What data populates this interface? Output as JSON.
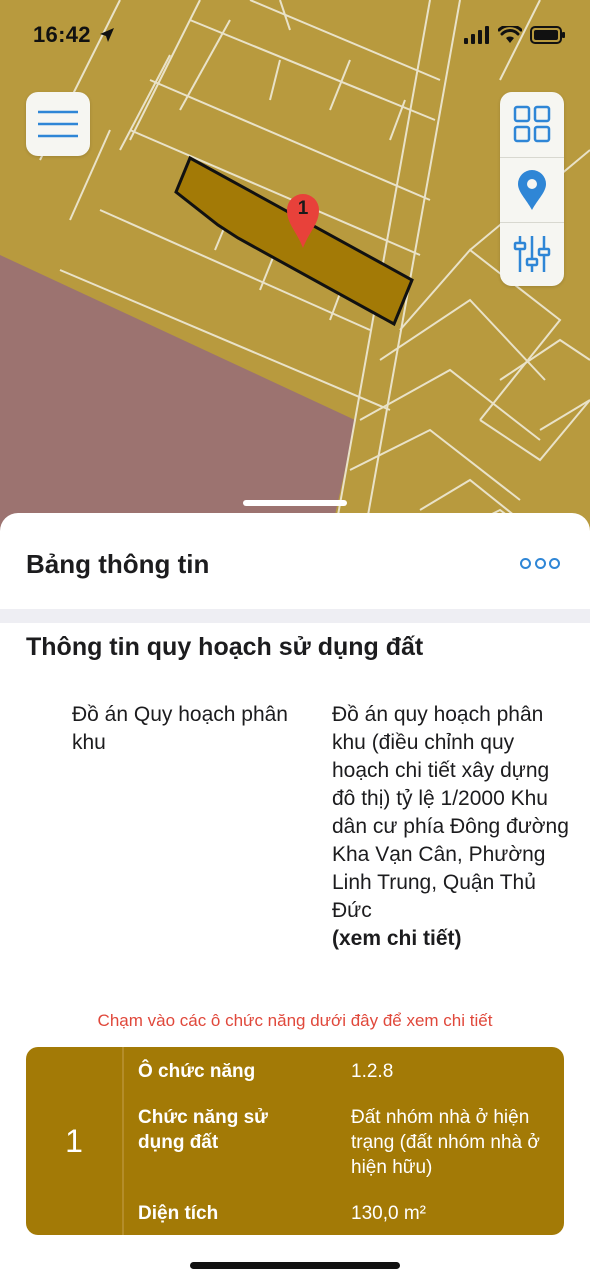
{
  "status_bar": {
    "time": "16:42"
  },
  "map": {
    "marker_label": "1"
  },
  "sheet": {
    "title": "Bảng thông tin",
    "section_title": "Thông tin quy hoạch sử dụng đất",
    "plan": {
      "label": "Đồ án Quy hoạch phân khu",
      "value": "Đồ án quy hoạch phân khu (điều chỉnh quy hoạch chi tiết xây dựng đô thị) tỷ lệ 1/2000 Khu dân cư phía Đông đường Kha Vạn Cân, Phường Linh Trung, Quận Thủ Đức",
      "link": "(xem chi tiết)"
    },
    "hint": "Chạm vào các ô chức năng dưới đây để xem chi tiết",
    "zone": {
      "number": "1",
      "rows": [
        {
          "key": "Ô chức năng",
          "value": "1.2.8"
        },
        {
          "key": "Chức năng sử dụng đất",
          "value": "Đất nhóm nhà ở hiện trạng (đất nhóm nhà ở hiện hữu)"
        },
        {
          "key": "Diện tích",
          "value": "130,0 m²"
        }
      ]
    }
  },
  "colors": {
    "map_land": "#b89a3e",
    "map_pink": "#9c7370",
    "selected_parcel": "#a37a06",
    "accent_blue": "#2f86d6",
    "hint_red": "#e0483b",
    "marker_red": "#e8413a"
  },
  "icons": [
    "navigation-arrow-icon",
    "signal-icon",
    "wifi-icon",
    "battery-icon",
    "menu-icon",
    "grid-icon",
    "location-pin-icon",
    "sliders-icon",
    "more-icon"
  ]
}
